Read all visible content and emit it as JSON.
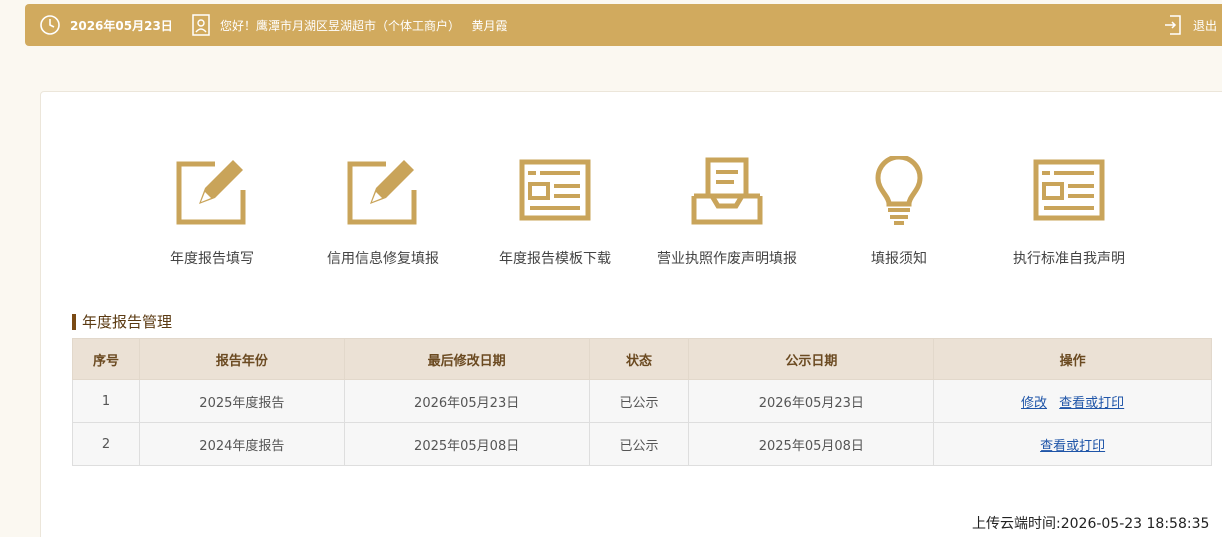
{
  "header": {
    "date": "2026年05月23日",
    "greeting": "您好！鹰潭市月湖区昱湖超市（个体工商户）",
    "user_name": "黄月霞",
    "logout_label": "退出",
    "icons": [
      "clock-icon",
      "user-badge-icon",
      "logout-icon"
    ]
  },
  "tiles": [
    {
      "label": "年度报告填写",
      "icon": "edit-form-icon"
    },
    {
      "label": "信用信息修复填报",
      "icon": "edit-form-icon"
    },
    {
      "label": "年度报告模板下载",
      "icon": "template-icon"
    },
    {
      "label": "营业执照作废声明填报",
      "icon": "inbox-document-icon"
    },
    {
      "label": "填报须知",
      "icon": "lightbulb-icon"
    },
    {
      "label": "执行标准自我声明",
      "icon": "template-icon"
    }
  ],
  "section_title": "年度报告管理",
  "table": {
    "headers": [
      "序号",
      "报告年份",
      "最后修改日期",
      "状态",
      "公示日期",
      "操作"
    ],
    "rows": [
      {
        "no": "1",
        "year": "2025年度报告",
        "modified": "2026年05月23日",
        "status": "已公示",
        "published": "2026年05月23日",
        "actions": [
          "修改",
          "查看或打印"
        ]
      },
      {
        "no": "2",
        "year": "2024年度报告",
        "modified": "2025年05月08日",
        "status": "已公示",
        "published": "2025年05月08日",
        "actions": [
          "查看或打印"
        ]
      }
    ]
  },
  "upload_time": "上传云端时间:2026-05-23 18:58:35",
  "colors": {
    "accent": "#d1aa5e",
    "icon_gold": "#c9a45a",
    "header_bg": "#ebe1d5",
    "link": "#1f55a8"
  }
}
